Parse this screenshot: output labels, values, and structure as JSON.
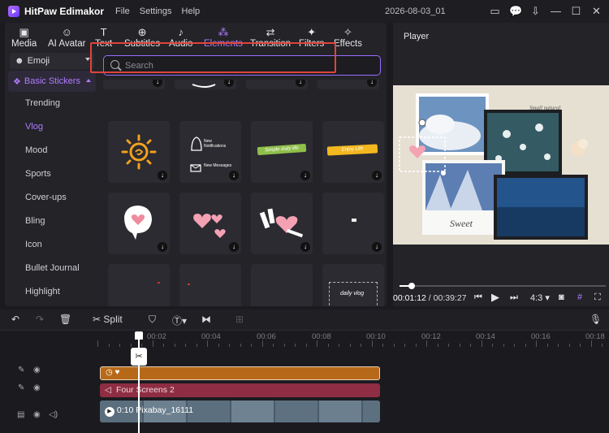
{
  "app": {
    "name": "HitPaw Edimakor",
    "doc_title": "2026-08-03_01"
  },
  "menu": [
    "File",
    "Settings",
    "Help"
  ],
  "tabs": [
    {
      "label": "Media",
      "icon": "media-icon"
    },
    {
      "label": "AI Avatar",
      "icon": "ai-avatar-icon"
    },
    {
      "label": "Text",
      "icon": "text-icon"
    },
    {
      "label": "Subtitles",
      "icon": "subtitles-icon"
    },
    {
      "label": "Audio",
      "icon": "audio-icon"
    },
    {
      "label": "Elements",
      "icon": "elements-icon",
      "active": true
    },
    {
      "label": "Transition",
      "icon": "transition-icon"
    },
    {
      "label": "Filters",
      "icon": "filters-icon"
    },
    {
      "label": "Effects",
      "icon": "effects-icon"
    }
  ],
  "sidebar": {
    "dropdown": "Emoji",
    "section": "Basic Stickers",
    "items": [
      "Trending",
      "Vlog",
      "Mood",
      "Sports",
      "Cover-ups",
      "Bling",
      "Icon",
      "Bullet Journal",
      "Highlight"
    ],
    "active_item": "Vlog"
  },
  "search": {
    "placeholder": "Search"
  },
  "stickers": {
    "notif1": "New Notifications",
    "notif2": "New Messages",
    "simple": "Simple daily life",
    "enjoy": "Enjoy Life",
    "daily": "daily vlog"
  },
  "player": {
    "title": "Player",
    "current_time": "00:01:12",
    "total_time": "00:39:27",
    "aspect": "4:3",
    "progress": 0.06,
    "preview_text_1": "Sweet",
    "preview_text_2": "Small natural"
  },
  "toolbar": {
    "split": "Split"
  },
  "ruler": [
    "00:02",
    "00:04",
    "00:06",
    "00:08",
    "00:10",
    "00:12",
    "00:14",
    "00:16",
    "00:18"
  ],
  "tracks": {
    "red_clip": "Four Screens 2",
    "video_clip": "0:10 Pixabay_16111"
  },
  "colors": {
    "accent": "#b07cff",
    "highlight": "#e0443a",
    "clip_orange": "#b7691a",
    "clip_red": "#8e2d43"
  }
}
